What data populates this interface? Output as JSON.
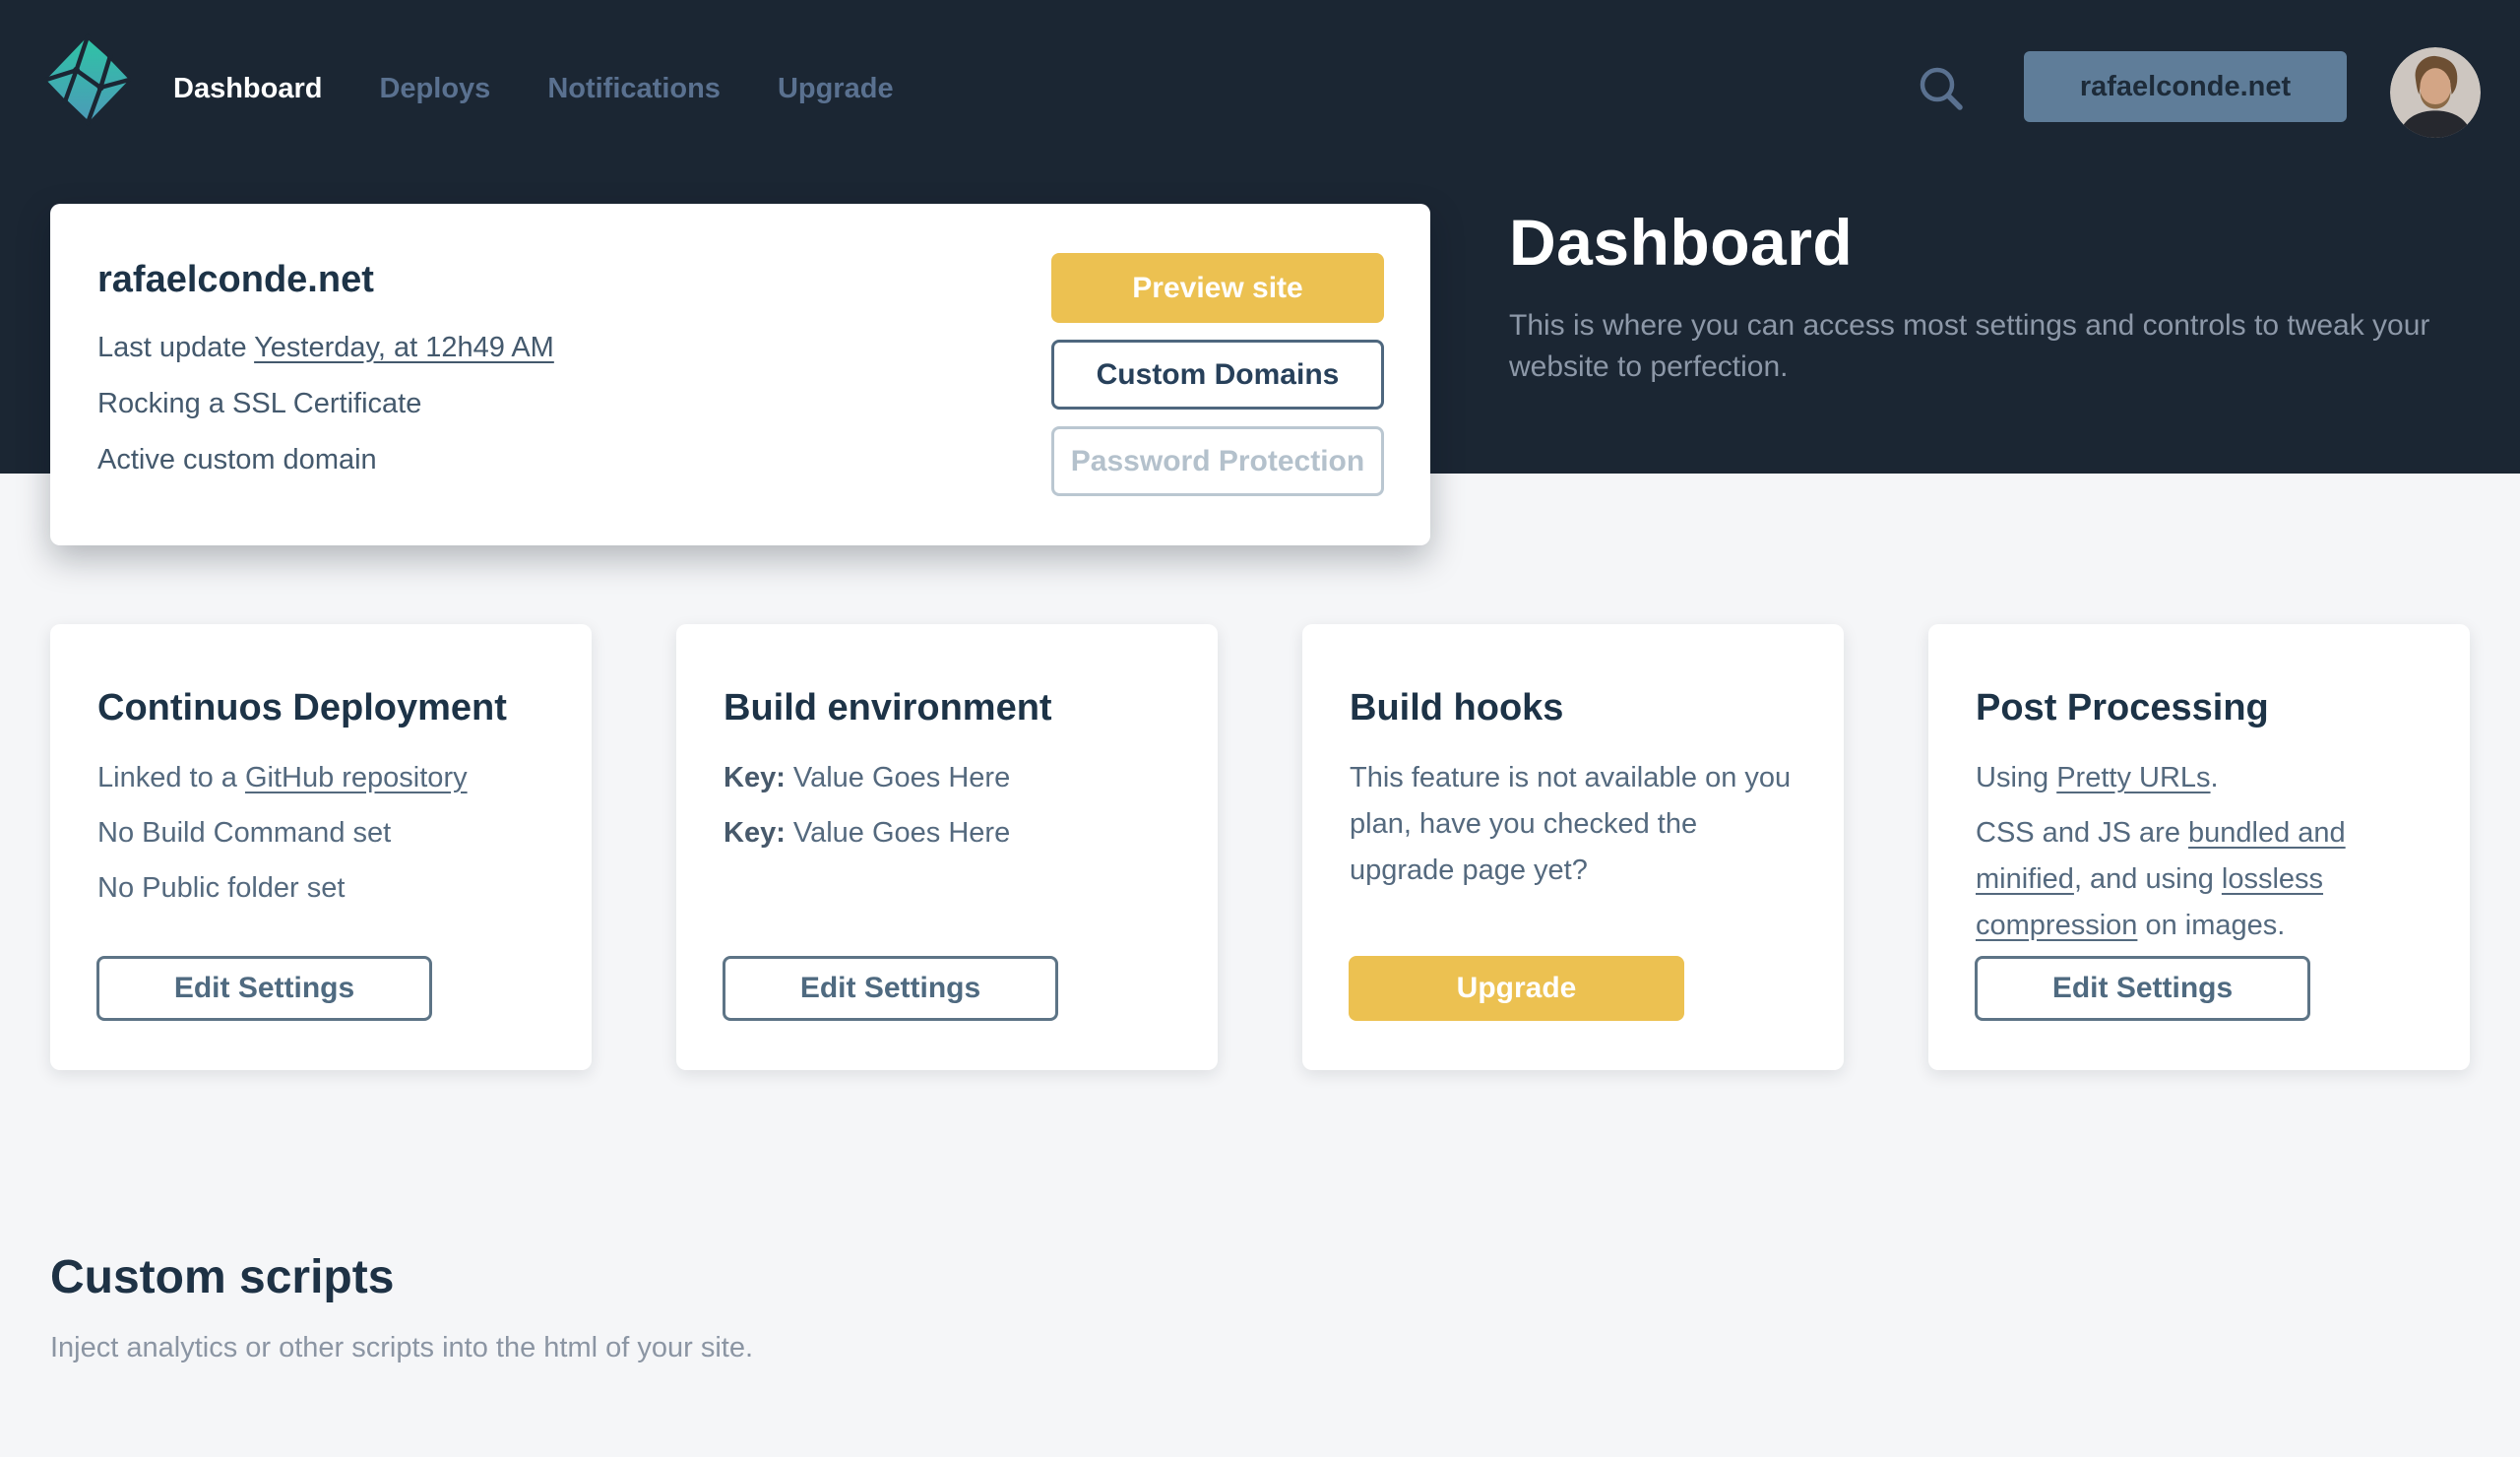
{
  "colors": {
    "header_bg": "#1b2633",
    "page_bg": "#f5f6f8",
    "accent_gold": "#ecc151",
    "navy_text": "#1d3347",
    "slate_text": "#54697e",
    "nav_inactive": "#5a7190",
    "account_pill_bg": "#5f7d99",
    "hero_subtitle": "#8d98a8",
    "logo_gradient_top": "#2ec4a5",
    "logo_gradient_bottom": "#4c9ab8"
  },
  "icons": {
    "logo": "netlify-logo",
    "search": "search-icon",
    "avatar": "avatar"
  },
  "nav": {
    "items": [
      {
        "label": "Dashboard",
        "active": true
      },
      {
        "label": "Deploys",
        "active": false
      },
      {
        "label": "Notifications",
        "active": false
      },
      {
        "label": "Upgrade",
        "active": false
      }
    ],
    "account_label": "rafaelconde.net"
  },
  "hero": {
    "title": "Dashboard",
    "subtitle": "This is where you can access most settings and controls to tweak your website to perfection."
  },
  "site_card": {
    "title": "rafaelconde.net",
    "last_update_prefix": "Last update ",
    "last_update_link": "Yesterday, at 12h49 AM",
    "ssl_status": "Rocking a SSL Certificate",
    "domain_status": "Active custom domain",
    "buttons": {
      "preview": "Preview site",
      "domains": "Custom Domains",
      "password": "Password Protection"
    }
  },
  "cards": [
    {
      "id": "continuous-deployment",
      "title": "Continuos Deployment",
      "paragraphs": [
        [
          {
            "t": "Linked to a "
          },
          {
            "t": "GitHub repository",
            "link": true,
            "name": "github-repository-link"
          }
        ],
        [
          {
            "t": "No Build Command set"
          }
        ],
        [
          {
            "t": "No Public folder set"
          }
        ]
      ],
      "action": {
        "label": "Edit Settings",
        "style": "outline",
        "name": "continuous-deployment-edit-settings-button"
      }
    },
    {
      "id": "build-environment",
      "title": "Build environment",
      "paragraphs": [
        [
          {
            "t": "Key:",
            "bold": true
          },
          {
            "t": " Value Goes Here"
          }
        ],
        [
          {
            "t": "Key:",
            "bold": true
          },
          {
            "t": " Value Goes Here"
          }
        ]
      ],
      "action": {
        "label": "Edit Settings",
        "style": "outline",
        "name": "build-environment-edit-settings-button"
      }
    },
    {
      "id": "build-hooks",
      "title": "Build hooks",
      "paragraphs": [
        [
          {
            "t": "This feature is not available on you plan, have you checked the upgrade page yet?"
          }
        ]
      ],
      "action": {
        "label": "Upgrade",
        "style": "gold",
        "name": "build-hooks-upgrade-button"
      }
    },
    {
      "id": "post-processing",
      "title": "Post Processing",
      "paragraphs": [
        [
          {
            "t": "Using "
          },
          {
            "t": "Pretty URLs",
            "link": true,
            "name": "pretty-urls-link"
          },
          {
            "t": "."
          }
        ],
        [
          {
            "t": "CSS and JS are "
          },
          {
            "t": "bundled and minified",
            "link": true,
            "name": "bundled-and-minified-link"
          },
          {
            "t": ", and using "
          },
          {
            "t": "lossless compression",
            "link": true,
            "name": "lossless-compression-link"
          },
          {
            "t": " on images."
          }
        ]
      ],
      "action": {
        "label": "Edit Settings",
        "style": "outline",
        "name": "post-processing-edit-settings-button"
      }
    }
  ],
  "custom_scripts": {
    "title": "Custom scripts",
    "subtitle": "Inject analytics or other scripts into the html of your site."
  }
}
